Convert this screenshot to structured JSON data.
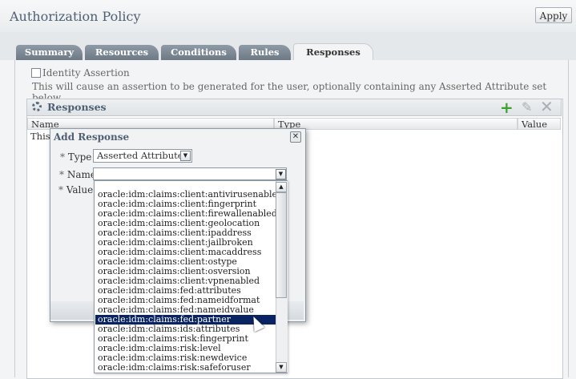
{
  "page": {
    "title": "Authorization Policy",
    "apply_label": "Apply"
  },
  "tabs": [
    {
      "label": "Summary"
    },
    {
      "label": "Resources"
    },
    {
      "label": "Conditions"
    },
    {
      "label": "Rules"
    },
    {
      "label": "Responses",
      "active": true
    }
  ],
  "identity_assertion": {
    "checked": false,
    "label": "Identity Assertion",
    "description": "This will cause an assertion to be generated for the user, optionally containing any Asserted Attribute set below."
  },
  "responses": {
    "title": "Responses",
    "icons": [
      "gear-icon",
      "add-icon",
      "edit-icon",
      "delete-icon"
    ],
    "columns": [
      "Name",
      "Type",
      "Value"
    ],
    "partial_row_text": "This",
    "partial_row_text2": "his"
  },
  "dialog": {
    "title": "Add Response",
    "close_glyph": "✕",
    "type_label": "Type",
    "type_value": "Asserted Attribute",
    "name_label": "Name",
    "name_value": "",
    "value_label": "Value",
    "required_marker": "*"
  },
  "name_options": [
    "oracle:idm:claims:client:antivirusenabled",
    "oracle:idm:claims:client:fingerprint",
    "oracle:idm:claims:client:firewallenabled",
    "oracle:idm:claims:client:geolocation",
    "oracle:idm:claims:client:ipaddress",
    "oracle:idm:claims:client:jailbroken",
    "oracle:idm:claims:client:macaddress",
    "oracle:idm:claims:client:ostype",
    "oracle:idm:claims:client:osversion",
    "oracle:idm:claims:client:vpnenabled",
    "oracle:idm:claims:fed:attributes",
    "oracle:idm:claims:fed:nameidformat",
    "oracle:idm:claims:fed:nameidvalue",
    "oracle:idm:claims:fed:partner",
    "oracle:idm:claims:ids:attributes",
    "oracle:idm:claims:risk:fingerprint",
    "oracle:idm:claims:risk:level",
    "oracle:idm:claims:risk:newdevice",
    "oracle:idm:claims:risk:safeforuser"
  ],
  "selected_option": "oracle:idm:claims:fed:partner"
}
